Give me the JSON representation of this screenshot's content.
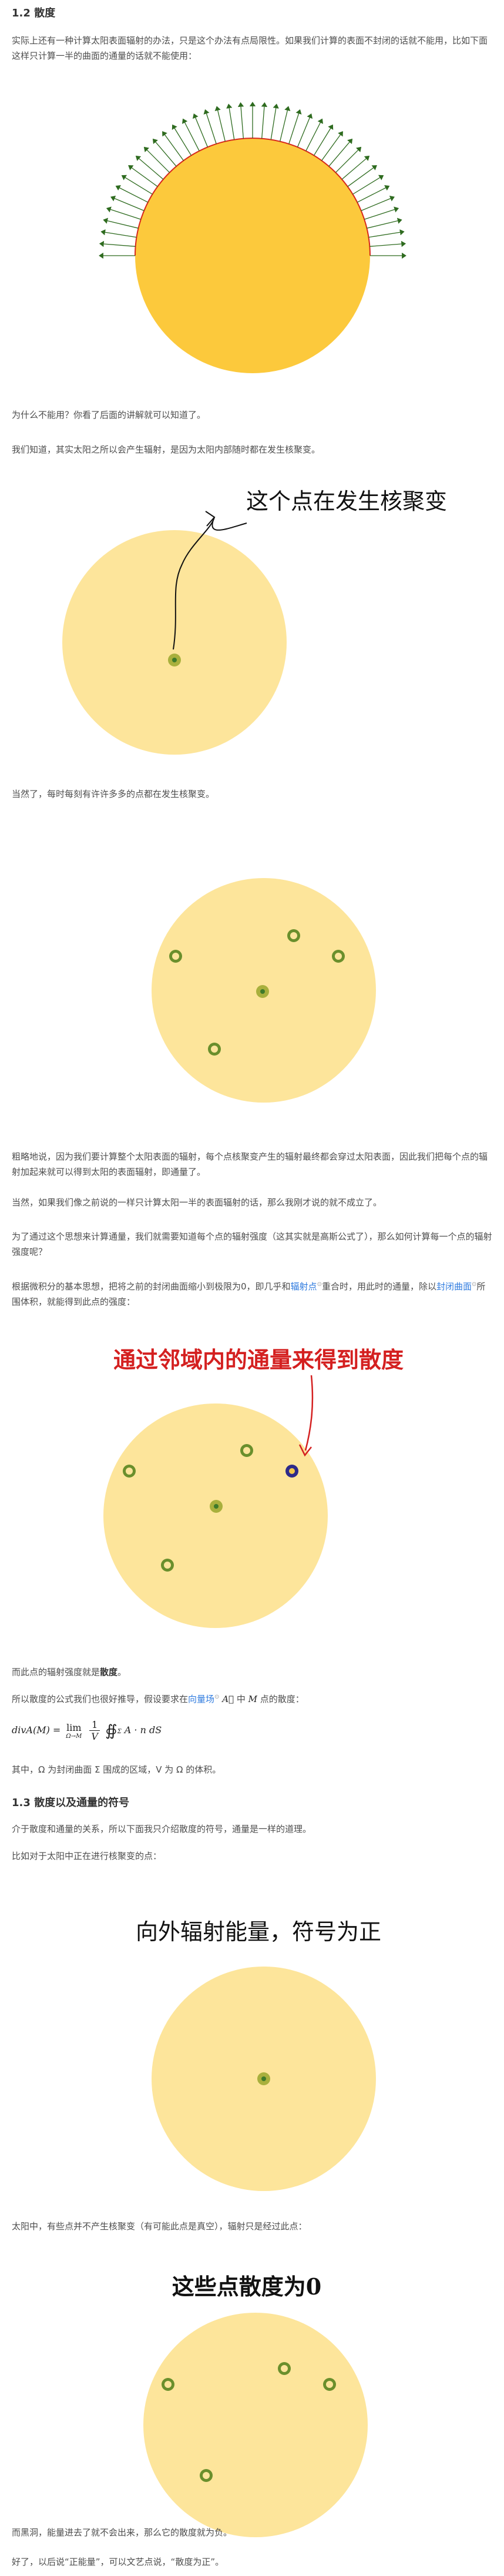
{
  "section1": {
    "heading": "1.2 散度",
    "para_intro": "实际上还有一种计算太阳表面辐射的办法，只是这个办法有点局限性。如果我们计算的表面不封闭的话就不能用，比如下面这样只计算一半的曲面的通量的话就不能使用：",
    "para_why": "为什么不能用？你看了后面的讲解就可以知道了。",
    "para_know": "我们知道，其实太阳之所以会产生辐射，是因为太阳内部随时都在发生核聚变。",
    "fig2_caption": "这个点在发生核聚变",
    "para_of_course": "当然了，每时每刻有许许多多的点都在发生核聚变。",
    "para_roughly": "粗略地说，因为我们要计算整个太阳表面的辐射，每个点核聚变产生的辐射最终都会穿过太阳表面，因此我们把每个点的辐射加起来就可以得到太阳的表面辐射，即通量了。",
    "para_not_hold": "当然，如果我们像之前说的一样只计算太阳一半的表面辐射的话，那么我刚才说的就不成立了。",
    "para_idea": "为了通过这个思想来计算通量，我们就需要知道每个点的辐射强度（这其实就是高斯公式了），那么如何计算每一个点的辐射强度呢？",
    "para_calculus_1": "根据微积分的基本思想，把将之前的封闭曲面缩小到极限为0，即几乎和",
    "para_calculus_link1": "辐射点",
    "para_calculus_2": "重合时，用此时的通量，除以",
    "para_calculus_link2": "封闭曲面",
    "para_calculus_3": "所围体积，就能得到此点的强度：",
    "fig4_caption": "通过邻域内的通量来得到散度",
    "para_divergence_1": "而此点的辐射强度就是",
    "para_divergence_bold": "散度",
    "para_divergence_2": "。",
    "para_formula_1": "所以散度的公式我们也很好推导，假设要求在",
    "para_formula_link": "向量场",
    "para_formula_2": "中",
    "para_formula_3": "点的散度：",
    "formula": "divA(M) = lim_{Ω→M} (1/V) ∯_Σ A · n dS",
    "formula_lhs": "divA(M) = ",
    "formula_lim": "lim",
    "formula_lim_sub": "Ω→M",
    "formula_frac_num": "1",
    "formula_frac_den": "V",
    "formula_integral": "∯",
    "formula_integral_sub": "Σ",
    "formula_body": "A · n dS",
    "para_where": "其中，Ω 为封闭曲面 Σ 围成的区域，V 为 Ω 的体积。"
  },
  "section2": {
    "heading": "1.3 散度以及通量的符号",
    "para_sign": "介于散度和通量的关系，所以下面我只介绍散度的符号，通量是一样的道理。",
    "para_example": "比如对于太阳中正在进行核聚变的点：",
    "fig5_caption": "向外辐射能量，符号为正",
    "para_sun_zero": "太阳中，有些点并不产生核聚变（有可能此点是真空），辐射只是经过此点：",
    "fig6_caption": "这些点散度为0",
    "para_black_hole": "而黑洞，能量进去了就不会出来，那么它的散度就为负。",
    "para_ok": "好了，以后说“正能量”，可以文艺点说，“散度为正”。"
  },
  "colors": {
    "sun_fill": "#fde59b",
    "sun_core": "#f7c52f",
    "arrow_green": "#2e6b1f",
    "caption_red": "#d42020",
    "link_blue": "#2f7bdf"
  },
  "icons": {
    "arrow": "green-arrow-icon",
    "pointer": "hand-drawn-arrow"
  }
}
